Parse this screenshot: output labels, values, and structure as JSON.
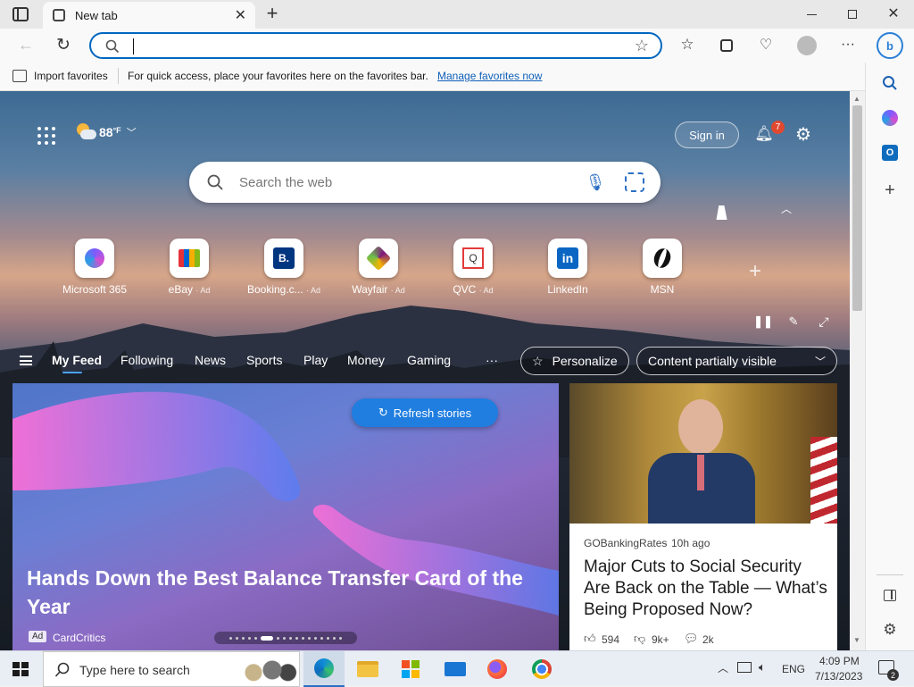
{
  "browser": {
    "tab_title": "New tab",
    "import_favorites": "Import favorites",
    "favbar_message": "For quick access, place your favorites here on the favorites bar.",
    "manage_favorites": "Manage favorites now",
    "accent": "#0067c0"
  },
  "page": {
    "weather_temp": "88",
    "weather_unit": "°F",
    "sign_in": "Sign in",
    "notification_count": "7",
    "search_placeholder": "Search the web",
    "tiles": [
      {
        "label": "Microsoft 365",
        "ad": ""
      },
      {
        "label": "eBay",
        "ad": "· Ad"
      },
      {
        "label": "Booking.c...",
        "ad": "· Ad"
      },
      {
        "label": "Wayfair",
        "ad": "· Ad"
      },
      {
        "label": "QVC",
        "ad": "· Ad"
      },
      {
        "label": "LinkedIn",
        "ad": ""
      },
      {
        "label": "MSN",
        "ad": ""
      }
    ],
    "nav": [
      "My Feed",
      "Following",
      "News",
      "Sports",
      "Play",
      "Money",
      "Gaming"
    ],
    "more": "···",
    "personalize": "Personalize",
    "content_visibility": "Content partially visible",
    "refresh_stories": "Refresh stories",
    "hero": {
      "headline": "Hands Down the Best Balance Transfer Card of the Year",
      "ad_badge": "Ad",
      "source": "CardCritics"
    },
    "side_story": {
      "source": "GOBankingRates",
      "time": "10h ago",
      "headline": "Major Cuts to Social Security Are Back on the Table — What’s Being Proposed Now?",
      "likes": "594",
      "dislikes": "9k+",
      "comments": "2k"
    },
    "tile_letters": {
      "booking": "B.",
      "linkedin": "in"
    }
  },
  "taskbar": {
    "search_placeholder": "Type here to search",
    "lang": "ENG",
    "time": "4:09 PM",
    "date": "7/13/2023",
    "notifications": "2"
  }
}
